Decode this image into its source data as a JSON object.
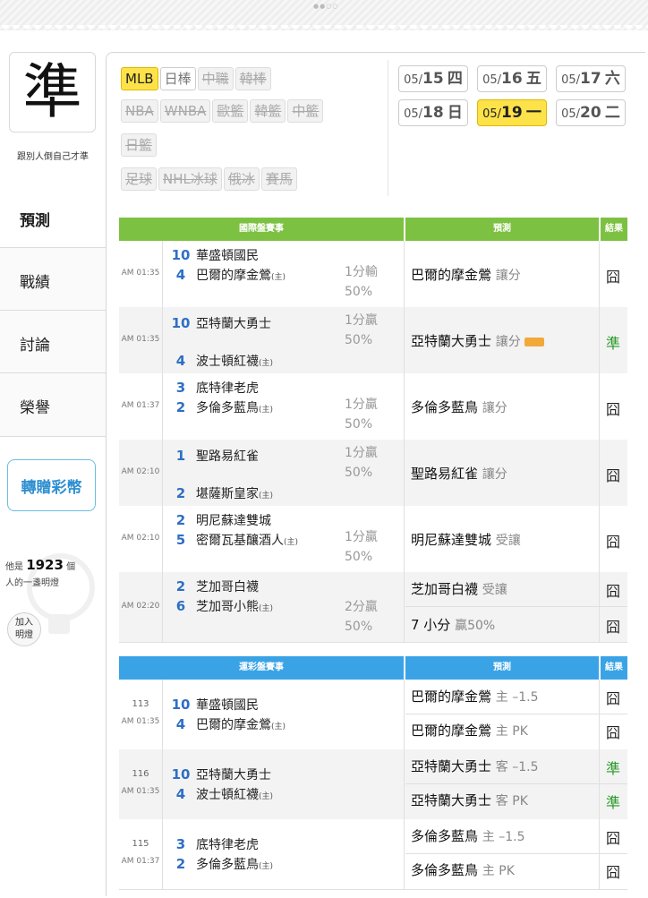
{
  "pager_dots": "●●○○",
  "sidebar": {
    "logo_char": "準",
    "slogan": "跟別人倒自己才準",
    "nav": [
      "預測",
      "戰績",
      "討論",
      "榮譽"
    ],
    "gift_button": "轉贈彩幣",
    "lamp": {
      "prefix": "他是",
      "count": "1923",
      "suffix": "個",
      "line2": "人的一盞明燈"
    },
    "join_button_line1": "加入",
    "join_button_line2": "明燈"
  },
  "leagues": {
    "row1": [
      {
        "label": "MLB",
        "state": "on"
      },
      {
        "label": "日棒",
        "state": "normal"
      },
      {
        "label": "中職",
        "state": "strike"
      },
      {
        "label": "韓棒",
        "state": "strike"
      }
    ],
    "row2": [
      {
        "label": "NBA",
        "state": "strike"
      },
      {
        "label": "WNBA",
        "state": "strike"
      },
      {
        "label": "歐籃",
        "state": "strike"
      },
      {
        "label": "韓籃",
        "state": "strike"
      },
      {
        "label": "中籃",
        "state": "strike"
      }
    ],
    "row3": [
      {
        "label": "日籃",
        "state": "strike"
      }
    ],
    "row4": [
      {
        "label": "足球",
        "state": "strike"
      },
      {
        "label": "NHL冰球",
        "state": "strike"
      },
      {
        "label": "俄冰",
        "state": "strike"
      },
      {
        "label": "賽馬",
        "state": "strike"
      }
    ]
  },
  "dates": [
    {
      "prefix": "05/",
      "day": "15",
      "wd": "四",
      "active": false
    },
    {
      "prefix": "05/",
      "day": "16",
      "wd": "五",
      "active": false
    },
    {
      "prefix": "05/",
      "day": "17",
      "wd": "六",
      "active": false
    },
    {
      "prefix": "05/",
      "day": "18",
      "wd": "日",
      "active": false
    },
    {
      "prefix": "05/",
      "day": "19",
      "wd": "一",
      "active": true
    },
    {
      "prefix": "05/",
      "day": "20",
      "wd": "二",
      "active": false
    }
  ],
  "colors": {
    "green_header": "#7dc142",
    "blue_header": "#3aa3e6",
    "win": "#2a9a2a",
    "highlight": "#fde24a"
  },
  "intl_table": {
    "header_games": "國際盤賽事",
    "header_pred": "預測",
    "header_result": "結果",
    "rows": [
      {
        "time": "AM 01:35",
        "p1": "10",
        "t1": "華盛頓國民",
        "p2": "4",
        "t2": "巴爾的摩金鶯",
        "home": "(主)",
        "odds1": "1分輸",
        "odds2": "50%",
        "pred": "巴爾的摩金鶯",
        "kind": "讓分",
        "result": "囧"
      },
      {
        "time": "AM 01:35",
        "p1": "10",
        "t1": "亞特蘭大勇士",
        "p2": "4",
        "t2": "波士頓紅襪",
        "home": "(主)",
        "odds1": "1分贏",
        "odds2": "50%",
        "pred": "亞特蘭大勇士",
        "kind": "讓分",
        "result": "準"
      },
      {
        "time": "AM 01:37",
        "p1": "3",
        "t1": "底特律老虎",
        "p2": "2",
        "t2": "多倫多藍鳥",
        "home": "(主)",
        "odds1": "1分贏",
        "odds2": "50%",
        "pred": "多倫多藍鳥",
        "kind": "讓分",
        "result": "囧"
      },
      {
        "time": "AM 02:10",
        "p1": "1",
        "t1": "聖路易紅雀",
        "p2": "2",
        "t2": "堪薩斯皇家",
        "home": "(主)",
        "odds1": "1分贏",
        "odds2": "50%",
        "pred": "聖路易紅雀",
        "kind": "讓分",
        "result": "囧"
      },
      {
        "time": "AM 02:10",
        "p1": "2",
        "t1": "明尼蘇達雙城",
        "p2": "5",
        "t2": "密爾瓦基釀酒人",
        "home": "(主)",
        "odds1": "1分贏",
        "odds2": "50%",
        "pred": "明尼蘇達雙城",
        "kind": "受讓",
        "result": "囧"
      },
      {
        "time": "AM 02:20",
        "p1": "2",
        "t1": "芝加哥白襪",
        "p2": "6",
        "t2": "芝加哥小熊",
        "home": "(主)",
        "odds1": "2分贏",
        "odds2": "50%",
        "pred": "芝加哥白襪",
        "kind": "受讓",
        "result": "囧",
        "pred_b": "7 小分",
        "kind_b": "贏50%",
        "result_b": "囧"
      }
    ]
  },
  "lottery_table": {
    "header_games": "運彩盤賽事",
    "header_pred": "預測",
    "header_result": "結果",
    "rows": [
      {
        "num": "113",
        "time": "AM 01:35",
        "p1": "10",
        "t1": "華盛頓國民",
        "p2": "4",
        "t2": "巴爾的摩金鶯",
        "home": "(主)",
        "preds": [
          {
            "team": "巴爾的摩金鶯",
            "kind": "主 –1.5",
            "result": "囧"
          },
          {
            "team": "巴爾的摩金鶯",
            "kind": "主 PK",
            "result": "囧"
          }
        ]
      },
      {
        "num": "116",
        "time": "AM 01:35",
        "p1": "10",
        "t1": "亞特蘭大勇士",
        "p2": "4",
        "t2": "波士頓紅襪",
        "home": "(主)",
        "preds": [
          {
            "team": "亞特蘭大勇士",
            "kind": "客 –1.5",
            "result": "準"
          },
          {
            "team": "亞特蘭大勇士",
            "kind": "客 PK",
            "result": "準"
          }
        ]
      },
      {
        "num": "115",
        "time": "AM 01:37",
        "p1": "3",
        "t1": "底特律老虎",
        "p2": "2",
        "t2": "多倫多藍鳥",
        "home": "(主)",
        "preds": [
          {
            "team": "多倫多藍鳥",
            "kind": "主 –1.5",
            "result": "囧"
          },
          {
            "team": "多倫多藍鳥",
            "kind": "主 PK",
            "result": "囧"
          }
        ]
      }
    ]
  }
}
